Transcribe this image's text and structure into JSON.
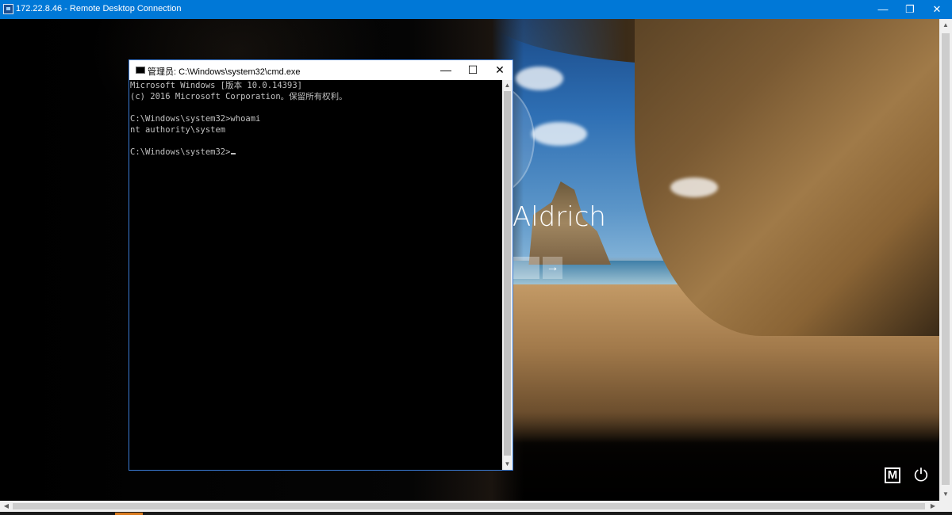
{
  "rdp_window": {
    "title": "172.22.8.46 - Remote Desktop Connection",
    "minimize": "—",
    "maximize": "❐",
    "close": "✕"
  },
  "lock_screen": {
    "user_name": "Aldrich",
    "submit_arrow": "→",
    "ease_of_access_label": "M",
    "power_icon": "⏻",
    "colors": {
      "sky": "#2e6fb4",
      "sand": "#a27a4b",
      "rock": "#7a5a33"
    }
  },
  "cmd_window": {
    "title": "管理员: C:\\Windows\\system32\\cmd.exe",
    "minimize": "—",
    "maximize": "☐",
    "close": "✕",
    "lines": [
      "Microsoft Windows [版本 10.0.14393]",
      "(c) 2016 Microsoft Corporation。保留所有权利。",
      "",
      "C:\\Windows\\system32>whoami",
      "nt authority\\system",
      "",
      "C:\\Windows\\system32>"
    ],
    "scroll_up": "▲",
    "scroll_down": "▼"
  },
  "scrollbars": {
    "up": "▲",
    "down": "▼",
    "left": "◀",
    "right": "▶"
  }
}
